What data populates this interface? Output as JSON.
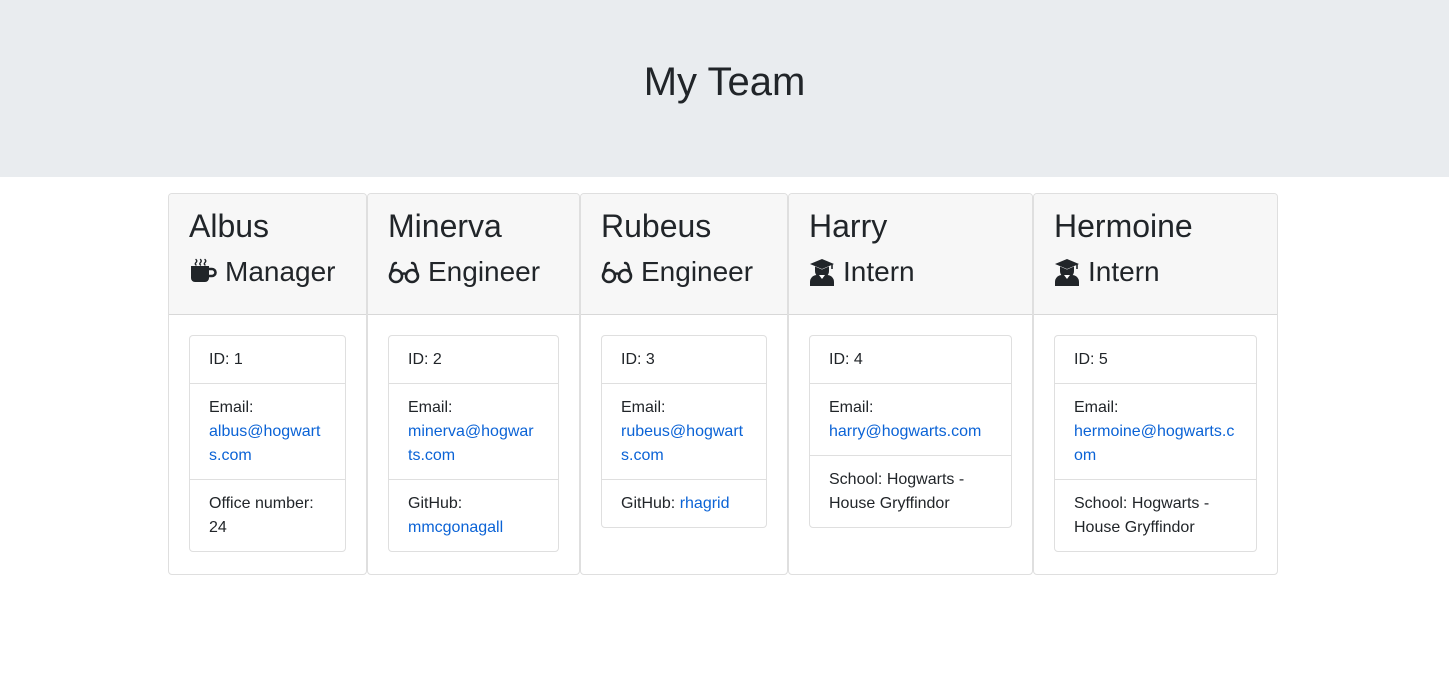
{
  "header": {
    "title": "My Team"
  },
  "colors": {
    "jumbotron_bg": "#e9ecef",
    "card_header_bg": "#f7f7f7",
    "link": "#0b63d6"
  },
  "team": [
    {
      "name": "Albus",
      "role": "Manager",
      "icon": "mug-icon",
      "id_text": "ID: 1",
      "email_label": "Email:",
      "email": "albus@hogwarts.com",
      "extra_label": "Office number:",
      "extra_value": "24"
    },
    {
      "name": "Minerva",
      "role": "Engineer",
      "icon": "glasses-icon",
      "id_text": "ID: 2",
      "email_label": "Email:",
      "email": "minerva@hogwarts.com",
      "extra_label": "GitHub:",
      "extra_value": "mmcgonagall"
    },
    {
      "name": "Rubeus",
      "role": "Engineer",
      "icon": "glasses-icon",
      "id_text": "ID: 3",
      "email_label": "Email:",
      "email": "rubeus@hogwarts.com",
      "extra_label": "GitHub:",
      "extra_value": "rhagrid"
    },
    {
      "name": "Harry",
      "role": "Intern",
      "icon": "graduate-icon",
      "id_text": "ID: 4",
      "email_label": "Email:",
      "email": "harry@hogwarts.com",
      "extra_label": "",
      "extra_value": "School: Hogwarts - House Gryffindor"
    },
    {
      "name": "Hermoine",
      "role": "Intern",
      "icon": "graduate-icon",
      "id_text": "ID: 5",
      "email_label": "Email:",
      "email": "hermoine@hogwarts.com",
      "extra_label": "",
      "extra_value": "School: Hogwarts - House Gryffindor"
    }
  ]
}
